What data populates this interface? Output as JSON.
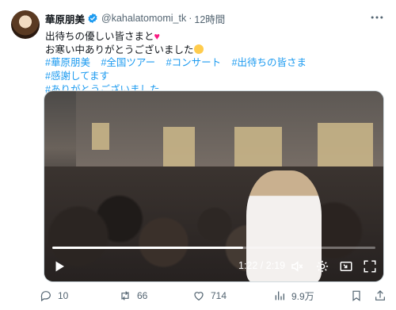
{
  "user": {
    "display_name": "華原朋美",
    "handle": "@kahalatomomi_tk",
    "separator": "·",
    "time": "12時間"
  },
  "tweet": {
    "line1": "出待ちの優しい皆さまと",
    "line2": "お寒い中ありがとうございました",
    "hashtags": [
      "#華原朋美",
      "#全国ツアー",
      "#コンサート",
      "#出待ちの皆さま",
      "#感謝してます",
      "#ありがとうございました"
    ]
  },
  "video": {
    "timecode": "1:22 / 2:19",
    "progress": 0.59
  },
  "actions": {
    "replies": "10",
    "retweets": "66",
    "likes": "714",
    "views": "9.9万"
  },
  "colors": {
    "accent": "#1d9bf0",
    "muted": "#536471",
    "heart": "#f91880"
  },
  "icons": [
    "verified-icon",
    "more-icon",
    "heart-icon",
    "emoji-icon",
    "play-icon",
    "volume-icon",
    "settings-icon",
    "pip-icon",
    "fullscreen-icon",
    "reply-icon",
    "retweet-icon",
    "like-icon",
    "views-icon",
    "bookmark-icon",
    "share-icon"
  ]
}
